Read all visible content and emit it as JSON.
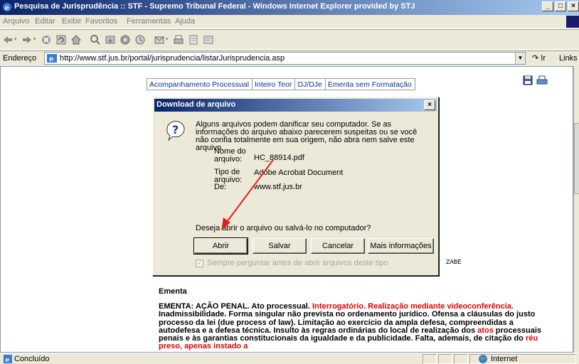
{
  "window": {
    "title": "Pesquisa de Jurisprudência :: STF - Supremo Tribunal Federal - Windows Internet Explorer provided by STJ",
    "controls": [
      "_",
      "□",
      "×"
    ]
  },
  "menubar": {
    "items": [
      "Arquivo",
      "Editar",
      "Exibir",
      "Favoritos",
      "Ferramentas",
      "Ajuda"
    ]
  },
  "toolbar": {
    "icons": [
      "back-icon",
      "forward-icon",
      "stop-icon",
      "refresh-icon",
      "home-icon",
      "search-icon",
      "favorites-icon",
      "media-icon",
      "history-icon",
      "mail-icon",
      "print-icon",
      "edit-icon",
      "discuss-icon"
    ]
  },
  "addressbar": {
    "label": "Endereço",
    "url": "http://www.stf.jus.br/portal/jurisprudencia/listarJurisprudencia.asp",
    "go_label": "Ir",
    "links_label": "Links"
  },
  "page": {
    "tabs": [
      "Acompanhamento Processual",
      "Inteiro Teor",
      "DJ/DJe",
      "Ementa sem Formatação"
    ],
    "fragment": "ZABE",
    "section_title": "Ementa",
    "ementa_segments": [
      {
        "text": "EMENTA: AÇÃO PENAL. Ato processual. ",
        "red": false
      },
      {
        "text": "Interrogatório. Realização mediante videoconferência.",
        "red": true
      },
      {
        "text": " Inadmissibilidade. Forma singular não prevista no ordenamento jurídico. Ofensa a cláusulas do justo processo da lei (due process of law). Limitação ao exercício da ampla defesa, compreendidas a autodefesa e a defesa técnica. Insulto às regras ordinárias do local de realização dos ",
        "red": false
      },
      {
        "text": "atos",
        "red": true
      },
      {
        "text": " processuais penais e às garantias constitucionais da igualdade e da publicidade. Falta, ademais, de citação do ",
        "red": false
      },
      {
        "text": "réu preso, apenas instado a",
        "red": true
      }
    ]
  },
  "dialog": {
    "title": "Download de arquivo",
    "warning": "Alguns arquivos podem danificar seu computador. Se as informações do arquivo abaixo parecerem suspeitas ou se você não confia totalmente em sua origem, não abra nem salve este arquivo.",
    "name_label": "Nome do arquivo:",
    "name_value": "HC_88914.pdf",
    "type_label": "Tipo de arquivo:",
    "type_value": "Adobe Acrobat Document",
    "from_label": "De:",
    "from_value": "www.stf.jus.br",
    "question": "Deseja abrir o arquivo ou salvá-lo no computador?",
    "buttons": {
      "open": "Abrir",
      "save": "Salvar",
      "cancel": "Cancelar",
      "more": "Mais informações"
    },
    "checkbox_label": "Sempre perguntar antes de abrir arquivos deste tipo",
    "checkbox_checked": true
  },
  "statusbar": {
    "text": "Concluído",
    "zone": "Internet"
  },
  "colors": {
    "titlebar": "#0a246a",
    "arrow": "#e02020",
    "link": "#003399",
    "highlight": "#e00000"
  }
}
